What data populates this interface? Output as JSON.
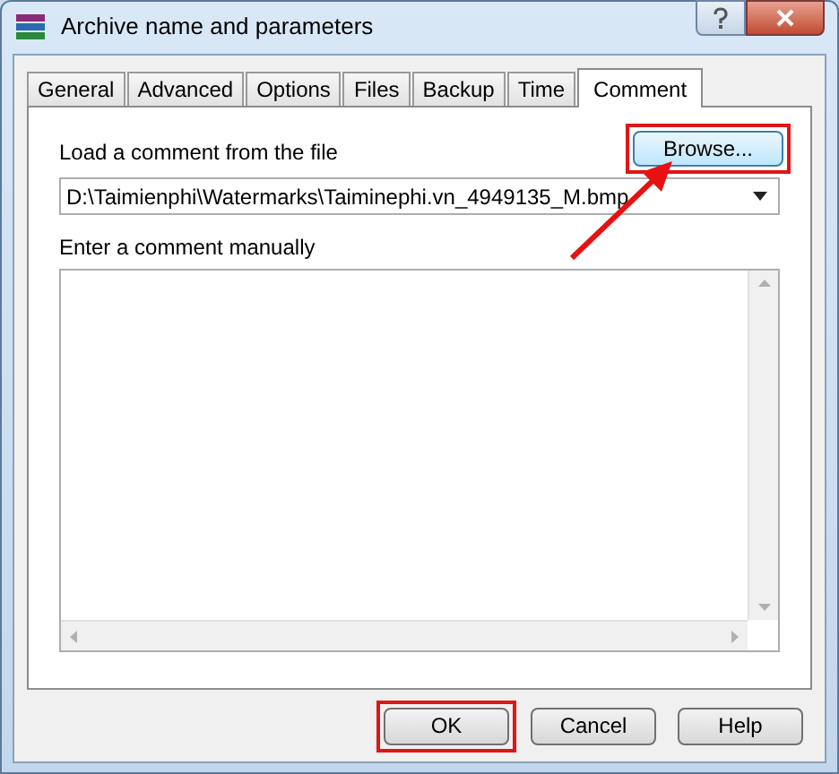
{
  "window": {
    "title": "Archive name and parameters"
  },
  "tabs": [
    {
      "label": "General",
      "selected": false
    },
    {
      "label": "Advanced",
      "selected": false
    },
    {
      "label": "Options",
      "selected": false
    },
    {
      "label": "Files",
      "selected": false
    },
    {
      "label": "Backup",
      "selected": false
    },
    {
      "label": "Time",
      "selected": false
    },
    {
      "label": "Comment",
      "selected": true
    }
  ],
  "load_label": "Load a comment from the file",
  "browse_button": {
    "label": "Browse...",
    "highlighted": true
  },
  "file_combo": {
    "value": "D:\\Taimienphi\\Watermarks\\Taiminephi.vn_4949135_M.bmp"
  },
  "manual_label": "Enter a comment manually",
  "buttons": [
    {
      "label": "OK",
      "highlighted": true
    },
    {
      "label": "Cancel",
      "highlighted": false
    },
    {
      "label": "Help",
      "highlighted": false
    }
  ]
}
